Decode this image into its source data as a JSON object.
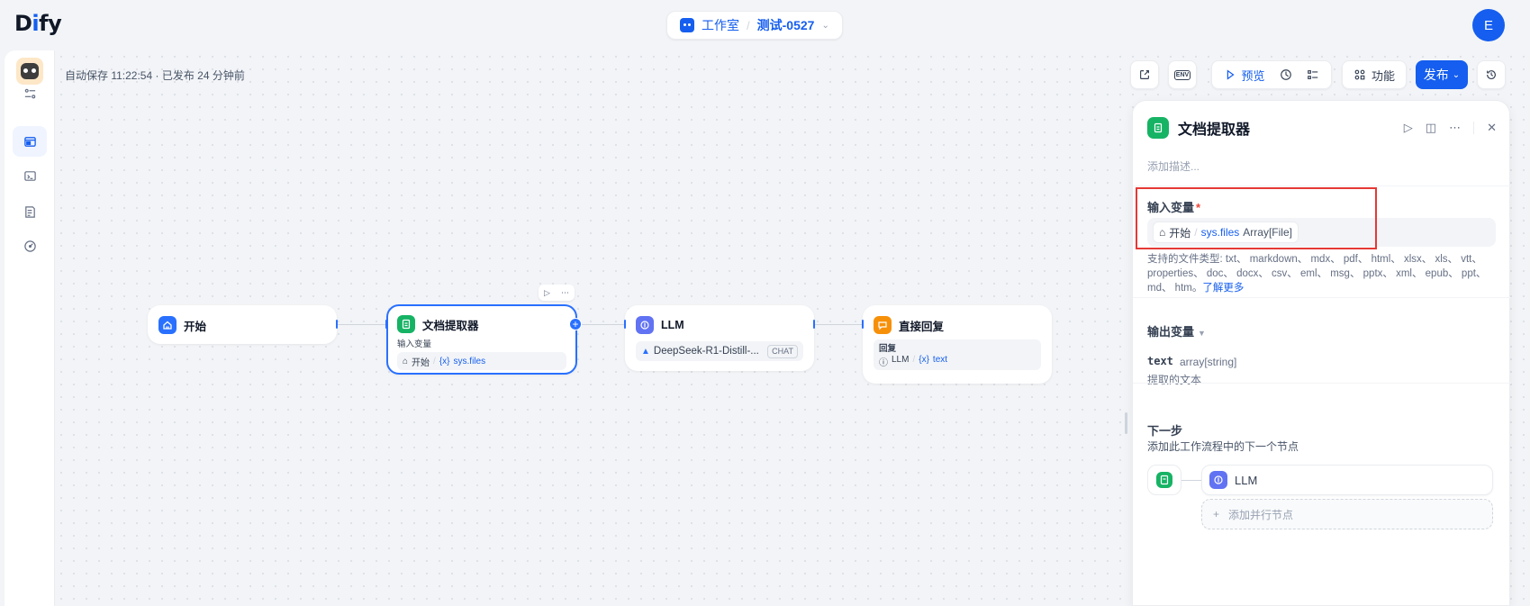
{
  "header": {
    "logo": {
      "part1": "D",
      "part2": "i",
      "part3": "fy"
    },
    "studio_label": "工作室",
    "separator": "/",
    "app_name": "测试-0527",
    "avatar_letter": "E"
  },
  "canvas": {
    "autosave_text": "自动保存 11:22:54 · 已发布 24 分钟前"
  },
  "toolbar": {
    "env_label": "ENV",
    "preview_label": "预览",
    "features_label": "功能",
    "publish_label": "发布"
  },
  "nodes": {
    "start": {
      "title": "开始"
    },
    "doc_extractor": {
      "title": "文档提取器",
      "input_label": "输入变量",
      "var_source": "开始",
      "var_prefix": "{x}",
      "var_name": "sys.files"
    },
    "llm": {
      "title": "LLM",
      "model": "DeepSeek-R1-Distill-...",
      "mode_tag": "CHAT"
    },
    "answer": {
      "title": "直接回复",
      "reply_label": "回复",
      "var_source": "LLM",
      "var_prefix": "{x}",
      "var_name": "text"
    }
  },
  "panel": {
    "title": "文档提取器",
    "description_placeholder": "添加描述...",
    "input_section": {
      "label": "输入变量",
      "required_mark": "*",
      "var_source": "开始",
      "var_name": "sys.files",
      "var_type": "Array[File]"
    },
    "support_text": "支持的文件类型: txt、 markdown、 mdx、 pdf、 html、 xlsx、 xls、 vtt、 properties、 doc、 docx、 csv、 eml、 msg、 pptx、 xml、 epub、 ppt、 md、 htm。",
    "learn_more": "了解更多",
    "output_section": {
      "label": "输出变量",
      "var_name": "text",
      "var_type": "array[string]",
      "var_desc": "提取的文本"
    },
    "next_section": {
      "label": "下一步",
      "description": "添加此工作流程中的下一个节点",
      "next_node": "LLM",
      "add_parallel": "添加并行节点"
    }
  },
  "colors": {
    "accent": "#155eef",
    "highlight_box": "#e53935",
    "doc_node": "#16b364",
    "llm_node": "#6172f3",
    "answer_node": "#f79009",
    "start_node": "#2970ff"
  }
}
